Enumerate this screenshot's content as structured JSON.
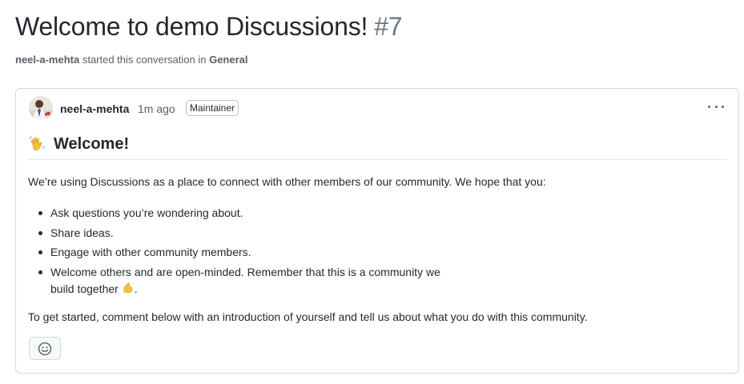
{
  "discussion": {
    "title": "Welcome to demo Discussions!",
    "number": "#7",
    "starter": "neel-a-mehta",
    "started_text": "started this conversation in",
    "category": "General"
  },
  "comment": {
    "author": "neel-a-mehta",
    "time": "1m ago",
    "badge": "Maintainer",
    "heading": "Welcome!",
    "intro": "We’re using Discussions as a place to connect with other members of our community. We hope that you:",
    "bullets": [
      "Ask questions you’re wondering about.",
      "Share ideas.",
      "Engage with other community members.",
      "Welcome others and are open-minded. Remember that this is a community we"
    ],
    "bullet_continuation": "build together",
    "bullet_end": ".",
    "outro": "To get started, comment below with an introduction of yourself and tell us about what you do with this community."
  },
  "icons": {
    "avatar": "avatar-photo",
    "heading_emoji": "waving-hand-icon",
    "bullet_emoji": "flexed-biceps-icon",
    "menu": "kebab-horizontal-icon",
    "reaction": "smiley-icon"
  }
}
